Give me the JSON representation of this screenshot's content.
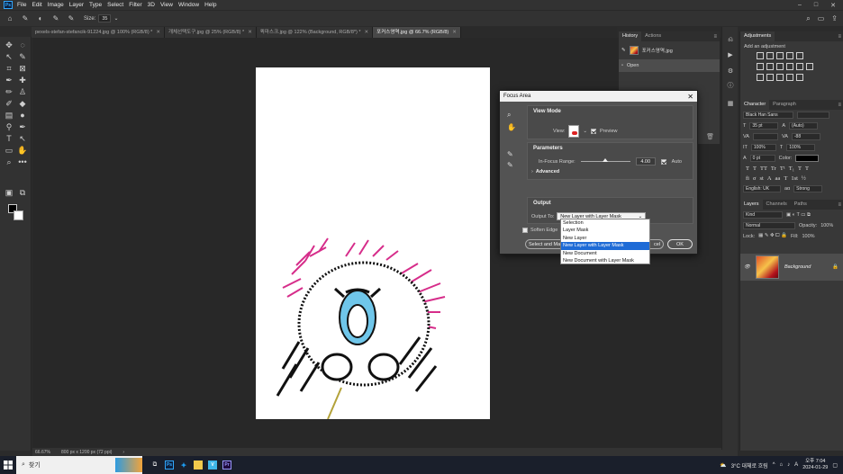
{
  "menubar": {
    "items": [
      "File",
      "Edit",
      "Image",
      "Layer",
      "Type",
      "Select",
      "Filter",
      "3D",
      "View",
      "Window",
      "Help"
    ],
    "window_controls": [
      "–",
      "□",
      "✕"
    ]
  },
  "options_bar": {
    "size_label": "Size:",
    "size_value": "35"
  },
  "tabs": [
    {
      "label": "pexels-stefan-stefancik-91224.jpg @ 100% (RGB/8) *"
    },
    {
      "label": "개체선택도구.jpg @ 25% (RGB/8) *"
    },
    {
      "label": "퀵마스크.jpg @ 122% (Background, RGB/8*) *"
    },
    {
      "label": "포커스영역.jpg @ 66.7% (RGB/8)"
    }
  ],
  "status": {
    "zoom": "66.67%",
    "doc_size": "800 px x 1200 px (72 ppi)"
  },
  "history": {
    "tabs": [
      "History",
      "Actions"
    ],
    "snapshot": "포커스영역.jpg",
    "items": [
      "Open"
    ]
  },
  "adjustments": {
    "title": "Adjustments",
    "subtitle": "Add an adjustment"
  },
  "character": {
    "tabs": [
      "Character",
      "Paragraph"
    ],
    "font_family": "Black Han Sans",
    "font_size": "35 pt",
    "tracking": "0",
    "vertical_scale": "100%",
    "baseline": "0 pt",
    "leading_label": "(Auto)",
    "kerning": "-88",
    "horizontal_scale": "100%",
    "color_label": "Color:",
    "language": "English: UK",
    "anti_alias": "Strong",
    "aa_label": "aɑ",
    "type_style_buttons": [
      "T",
      "T",
      "TT",
      "Tr",
      "T¹",
      "T₁",
      "T",
      "T"
    ],
    "opentype_buttons": [
      "fi",
      "σ",
      "st",
      "A",
      "aa",
      "T",
      "1st",
      "½"
    ]
  },
  "layers": {
    "tabs": [
      "Layers",
      "Channels",
      "Paths"
    ],
    "kind": "Kind",
    "blend_mode": "Normal",
    "opacity_label": "Opacity:",
    "opacity_value": "100%",
    "lock_label": "Lock:",
    "fill_label": "Fill:",
    "fill_value": "100%",
    "layer_name": "Background"
  },
  "dialog": {
    "title": "Focus Area",
    "view_mode_title": "View Mode",
    "view_label": "View:",
    "preview_label": "Preview",
    "parameters_title": "Parameters",
    "in_focus_label": "In-Focus Range:",
    "in_focus_value": "4.00",
    "in_focus_fraction": 0.5,
    "auto_label": "Auto",
    "advanced_label": "Advanced",
    "output_title": "Output",
    "output_to_label": "Output To:",
    "output_to_value": "New Layer with Layer Mask",
    "soften_label": "Soften Edge",
    "select_mask_label": "Select and Ma",
    "cancel_label": "cel",
    "ok_label": "OK"
  },
  "dropdown": {
    "options": [
      "Selection",
      "Layer Mask",
      "New Layer",
      "New Layer with Layer Mask",
      "New Document",
      "New Document with Layer Mask"
    ],
    "selected_index": 3
  },
  "taskbar": {
    "search_placeholder": "찾기",
    "weather": "3°C 대체로 흐림",
    "ime": "A",
    "time": "오후 7:04",
    "date": "2024-01-29",
    "app_ps": "Ps",
    "app_pr": "Pr"
  }
}
